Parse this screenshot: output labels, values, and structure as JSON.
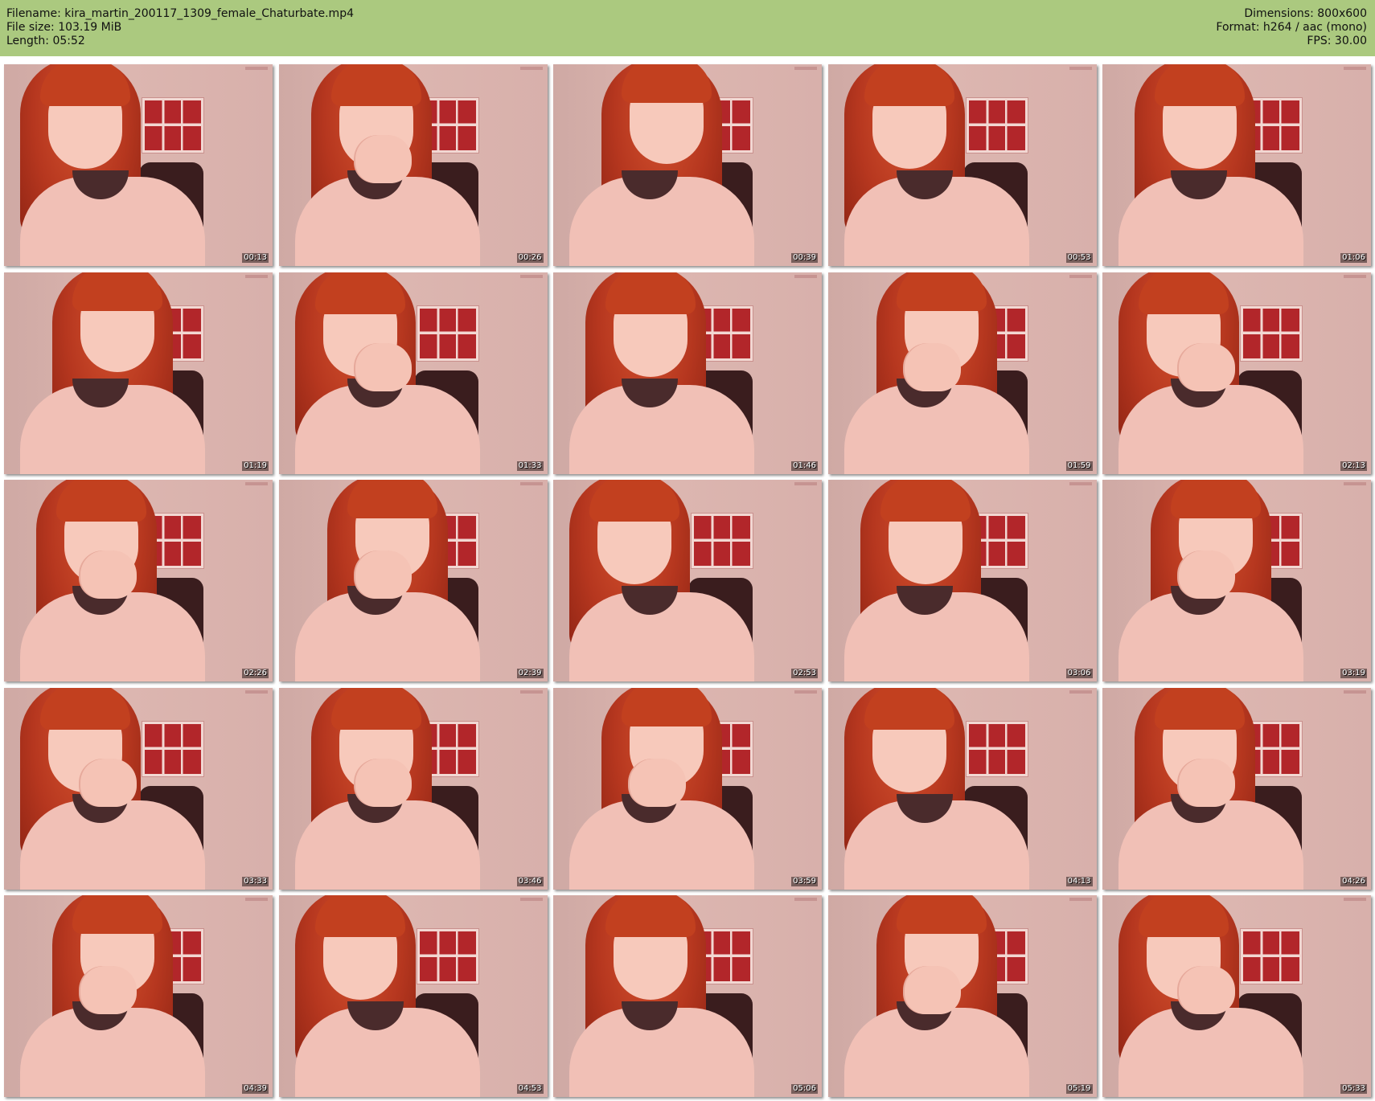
{
  "header": {
    "filename": "Filename: kira_martin_200117_1309_female_Chaturbate.mp4",
    "filesize": "File size: 103.19 MiB",
    "length": "Length: 05:52",
    "dimensions": "Dimensions: 800x600",
    "format": "Format: h264 / aac (mono)",
    "fps": "FPS: 30.00"
  },
  "thumbnails": [
    {
      "time": "00:13",
      "hand": false
    },
    {
      "time": "00:26",
      "hand": true
    },
    {
      "time": "00:39",
      "hand": false
    },
    {
      "time": "00:53",
      "hand": false
    },
    {
      "time": "01:06",
      "hand": false
    },
    {
      "time": "01:19",
      "hand": false
    },
    {
      "time": "01:33",
      "hand": true
    },
    {
      "time": "01:46",
      "hand": false
    },
    {
      "time": "01:59",
      "hand": true
    },
    {
      "time": "02:13",
      "hand": true
    },
    {
      "time": "02:26",
      "hand": true
    },
    {
      "time": "02:39",
      "hand": true
    },
    {
      "time": "02:53",
      "hand": false
    },
    {
      "time": "03:06",
      "hand": false
    },
    {
      "time": "03:19",
      "hand": true
    },
    {
      "time": "03:33",
      "hand": true
    },
    {
      "time": "03:46",
      "hand": true
    },
    {
      "time": "03:59",
      "hand": true
    },
    {
      "time": "04:13",
      "hand": false
    },
    {
      "time": "04:26",
      "hand": true
    },
    {
      "time": "04:39",
      "hand": true
    },
    {
      "time": "04:53",
      "hand": false
    },
    {
      "time": "05:06",
      "hand": false
    },
    {
      "time": "05:19",
      "hand": true
    },
    {
      "time": "05:33",
      "hand": true
    }
  ]
}
